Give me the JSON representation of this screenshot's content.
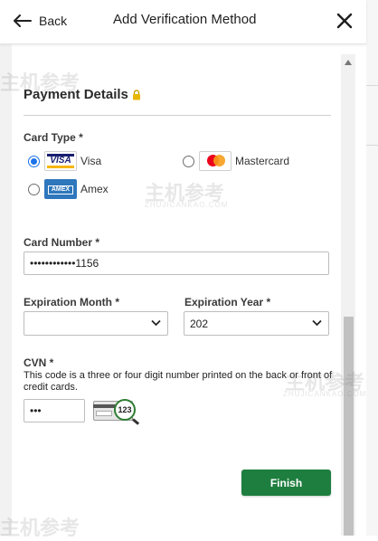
{
  "header": {
    "back_label": "Back",
    "title": "Add Verification Method"
  },
  "section": {
    "title": "Payment Details"
  },
  "card_type": {
    "label": "Card Type *",
    "options": [
      {
        "label": "Visa",
        "logo_text": "VISA",
        "selected": true
      },
      {
        "label": "Mastercard",
        "logo_text": "",
        "selected": false
      },
      {
        "label": "Amex",
        "logo_text": "AMEX",
        "selected": false
      }
    ]
  },
  "card_number": {
    "label": "Card Number *",
    "value": "••••••••••••1156"
  },
  "expiration_month": {
    "label": "Expiration Month *",
    "value": ""
  },
  "expiration_year": {
    "label": "Expiration Year *",
    "value": "202"
  },
  "cvn": {
    "label": "CVN *",
    "help": "This code is a three or four digit number printed on the back or front of credit cards.",
    "value": "•••",
    "card_image_text": "123"
  },
  "finish_label": "Finish",
  "watermark": {
    "text": "主机参考",
    "sub": "ZHUJICANKAO.COM"
  },
  "colors": {
    "finish": "#1e7e3f",
    "radio_selected": "#1a73e8",
    "lock": "#e8b800"
  }
}
